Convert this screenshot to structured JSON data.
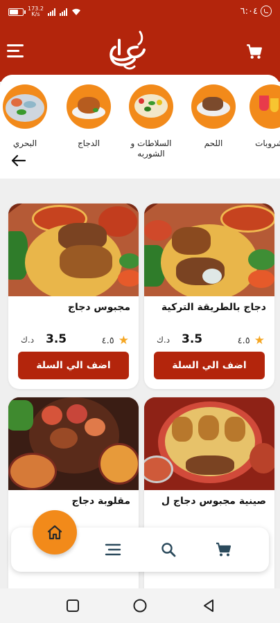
{
  "status_bar": {
    "time": "٦:٠٤",
    "speed_value": "173.2",
    "speed_unit": "K/s",
    "battery_level": 0.6
  },
  "header": {
    "logo_text": "علاء",
    "menu_icon": "menu-icon",
    "cart_icon": "cart-icon"
  },
  "categories": [
    {
      "label": "البحري",
      "icon": "seafood-icon"
    },
    {
      "label": "الدجاج",
      "icon": "chicken-icon"
    },
    {
      "label": "السلاطات و الشوربه",
      "icon": "salad-icon"
    },
    {
      "label": "اللحم",
      "icon": "meat-icon"
    },
    {
      "label": "مشروبات",
      "icon": "drinks-icon"
    }
  ],
  "products": [
    {
      "name": "دجاج بالطريقة التركية",
      "rating": "٤.٥",
      "price": "3.5",
      "currency": "د.ك",
      "button": "اضف الي السلة"
    },
    {
      "name": "مجبوس دجاج",
      "rating": "٤.٥",
      "price": "3.5",
      "currency": "د.ك",
      "button": "اضف الي السلة"
    },
    {
      "name": "صينية مجبوس دجاج ل",
      "rating": "",
      "price": "",
      "currency": "",
      "button": ""
    },
    {
      "name": "مقلوبة دجاج",
      "rating": "",
      "price": "",
      "currency": "",
      "button": ""
    }
  ],
  "colors": {
    "brand_red": "#b3250c",
    "accent_orange": "#f28a1a",
    "star": "#f5a623"
  },
  "bottom_nav": {
    "items": [
      "home-icon",
      "menu-list-icon",
      "search-icon",
      "cart-icon"
    ]
  }
}
